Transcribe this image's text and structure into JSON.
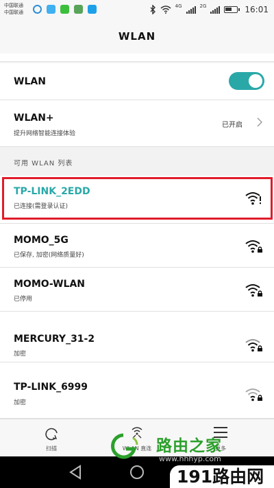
{
  "status_bar": {
    "carrier_1": "中国联通",
    "carrier_2": "中国联通",
    "net_1": "4G",
    "net_2": "2G",
    "time": "16:01"
  },
  "title": "WLAN",
  "wlan_toggle": {
    "label": "WLAN",
    "state": "on"
  },
  "wlan_plus": {
    "label": "WLAN+",
    "subtitle": "提升网络智能连接体验",
    "value": "已开启"
  },
  "section_header": "可用 WLAN 列表",
  "networks": [
    {
      "ssid": "TP-LINK_2EDD",
      "status": "已连接(需登录认证)",
      "connected": true,
      "highlighted": true,
      "icon": "wifi-alert-icon"
    },
    {
      "ssid": "MOMO_5G",
      "status": "已保存, 加密(网络质量好)",
      "connected": false,
      "icon": "wifi-lock-icon"
    },
    {
      "ssid": "MOMO-WLAN",
      "status": "已停用",
      "connected": false,
      "icon": "wifi-lock-icon"
    },
    {
      "ssid": "MERCURY_31-2",
      "status": "加密",
      "connected": false,
      "icon": "wifi-lock-icon"
    },
    {
      "ssid": "TP-LINK_6999",
      "status": "加密",
      "connected": false,
      "icon": "wifi-lock-icon"
    }
  ],
  "bottom_nav": [
    {
      "label": "扫描",
      "icon": "refresh-icon"
    },
    {
      "label": "WLAN 直连",
      "icon": "wifi-direct-icon"
    },
    {
      "label": "更多",
      "icon": "menu-icon"
    }
  ],
  "watermark": {
    "text": "路由之家",
    "url": "www.hhhyp.com",
    "badge": "191路由网"
  },
  "colors": {
    "accent": "#2aa8a8",
    "highlight_border": "#e11b2a",
    "watermark_green": "#2ca02c"
  }
}
